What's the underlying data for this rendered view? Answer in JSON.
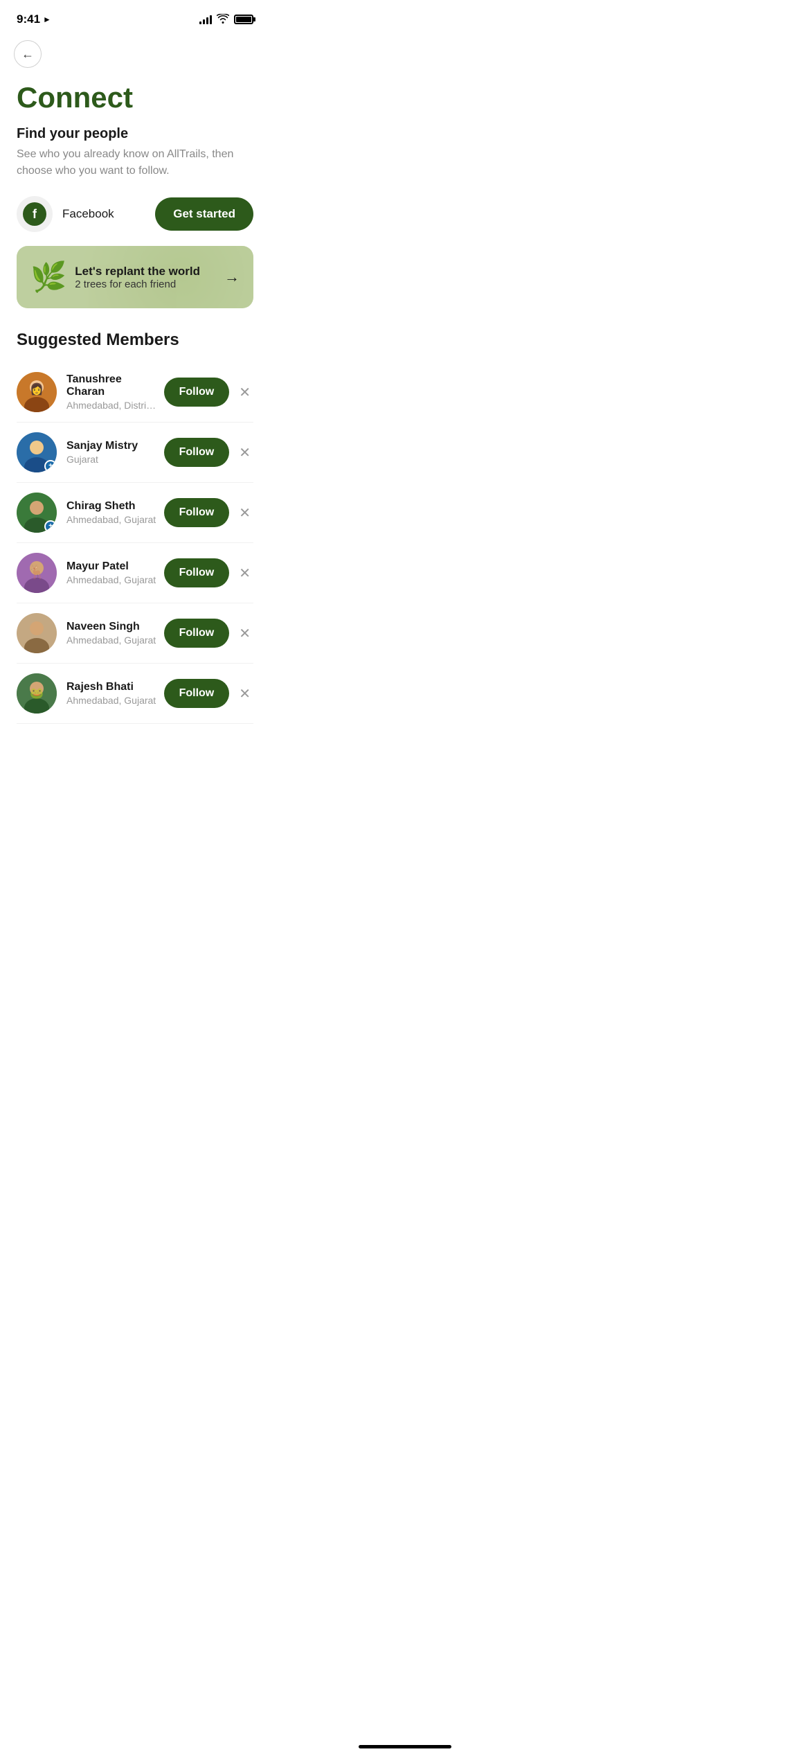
{
  "statusBar": {
    "time": "9:41",
    "hasLocationArrow": true
  },
  "nav": {
    "backLabel": "←"
  },
  "page": {
    "title": "Connect",
    "findPeople": {
      "heading": "Find your people",
      "description": "See who you already know on AllTrails, then choose who you want to follow."
    },
    "facebook": {
      "label": "Facebook",
      "buttonLabel": "Get started"
    },
    "replantBanner": {
      "title": "Let's replant the world",
      "subtitle": "2 trees for each friend",
      "arrowLabel": "→"
    },
    "suggestedMembers": {
      "heading": "Suggested Members",
      "followLabel": "Follow",
      "dismissLabel": "×",
      "members": [
        {
          "id": "tanushree",
          "name": "Tanushree Charan",
          "location": "Ahmedabad, District of Colu...",
          "hasBadge": false,
          "avatarColor": "tanushree"
        },
        {
          "id": "sanjay",
          "name": "Sanjay Mistry",
          "location": "Gujarat",
          "hasBadge": true,
          "avatarColor": "sanjay"
        },
        {
          "id": "chirag",
          "name": "Chirag Sheth",
          "location": "Ahmedabad, Gujarat",
          "hasBadge": true,
          "avatarColor": "chirag"
        },
        {
          "id": "mayur",
          "name": "Mayur Patel",
          "location": "Ahmedabad, Gujarat",
          "hasBadge": false,
          "avatarColor": "mayur"
        },
        {
          "id": "naveen",
          "name": "Naveen Singh",
          "location": "Ahmedabad, Gujarat",
          "hasBadge": false,
          "avatarColor": "naveen"
        },
        {
          "id": "rajesh",
          "name": "Rajesh Bhati",
          "location": "Ahmedabad, Gujarat",
          "hasBadge": false,
          "avatarColor": "rajesh"
        }
      ]
    }
  },
  "colors": {
    "primary": "#2d5a1b",
    "text": "#1a1a1a",
    "textMuted": "#888888"
  }
}
